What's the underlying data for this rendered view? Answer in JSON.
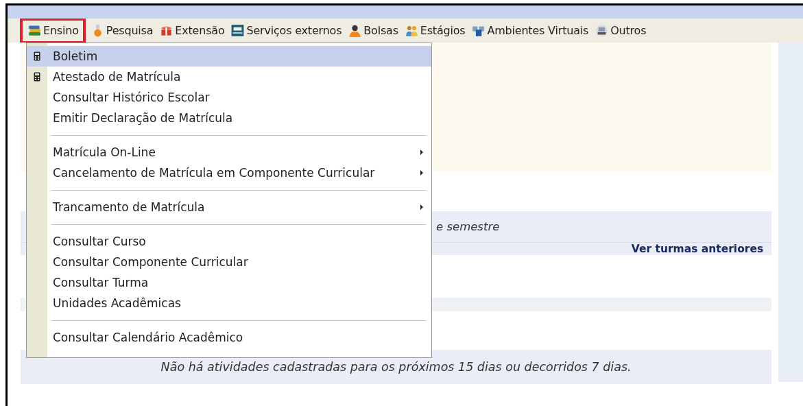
{
  "menubar": [
    {
      "label": "Ensino",
      "selected": true
    },
    {
      "label": "Pesquisa",
      "selected": false
    },
    {
      "label": "Extensão",
      "selected": false
    },
    {
      "label": "Serviços externos",
      "selected": false
    },
    {
      "label": "Bolsas",
      "selected": false
    },
    {
      "label": "Estágios",
      "selected": false
    },
    {
      "label": "Ambientes Virtuais",
      "selected": false
    },
    {
      "label": "Outros",
      "selected": false
    }
  ],
  "dropdown": [
    {
      "kind": "item",
      "label": "Boletim",
      "icon": true,
      "submenu": false,
      "selected": true
    },
    {
      "kind": "item",
      "label": "Atestado de Matrícula",
      "icon": true,
      "submenu": false,
      "selected": false
    },
    {
      "kind": "item",
      "label": "Consultar Histórico Escolar",
      "icon": false,
      "submenu": false,
      "selected": false
    },
    {
      "kind": "item",
      "label": "Emitir Declaração de Matrícula",
      "icon": false,
      "submenu": false,
      "selected": false
    },
    {
      "kind": "separator"
    },
    {
      "kind": "item",
      "label": "Matrícula On-Line",
      "icon": false,
      "submenu": true,
      "selected": false
    },
    {
      "kind": "item",
      "label": "Cancelamento de Matrícula em Componente Curricular",
      "icon": false,
      "submenu": true,
      "selected": false
    },
    {
      "kind": "separator"
    },
    {
      "kind": "item",
      "label": "Trancamento de Matrícula",
      "icon": false,
      "submenu": true,
      "selected": false
    },
    {
      "kind": "separator"
    },
    {
      "kind": "item",
      "label": "Consultar Curso",
      "icon": false,
      "submenu": false,
      "selected": false
    },
    {
      "kind": "item",
      "label": "Consultar Componente Curricular",
      "icon": false,
      "submenu": false,
      "selected": false
    },
    {
      "kind": "item",
      "label": "Consultar Turma",
      "icon": false,
      "submenu": false,
      "selected": false
    },
    {
      "kind": "item",
      "label": "Unidades Acadêmicas",
      "icon": false,
      "submenu": false,
      "selected": false
    },
    {
      "kind": "separator"
    },
    {
      "kind": "item",
      "label": "Consultar Calendário Acadêmico",
      "icon": false,
      "submenu": false,
      "selected": false
    }
  ],
  "classes_section": {
    "heading_fragment": "e semestre",
    "link": "Ver turmas anteriores"
  },
  "activities_section": {
    "empty_message": "Não há atividades cadastradas para os próximos 15 dias ou decorridos 7 dias."
  }
}
